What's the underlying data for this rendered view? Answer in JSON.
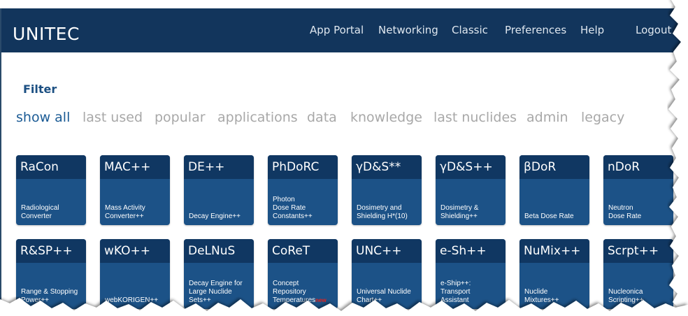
{
  "app": {
    "title": "UNITEC"
  },
  "nav": [
    {
      "id": "app-portal",
      "label": "App Portal"
    },
    {
      "id": "networking",
      "label": "Networking"
    },
    {
      "id": "classic",
      "label": "Classic"
    },
    {
      "id": "preferences",
      "label": "Preferences"
    },
    {
      "id": "help",
      "label": "Help"
    },
    {
      "id": "logout",
      "label": "Logout"
    }
  ],
  "filter": {
    "title": "Filter",
    "items": [
      "show all",
      "last used",
      "popular",
      "applications",
      "data",
      "knowledge",
      "last nuclides",
      "admin",
      "legacy"
    ],
    "active": "show all"
  },
  "tiles": [
    {
      "title": "RaCon",
      "desc": "Radiological\nConverter"
    },
    {
      "title": "MAC++",
      "desc": "Mass Activity\nConverter++"
    },
    {
      "title": "DE++",
      "desc": "Decay Engine++"
    },
    {
      "title": "PhDoRC",
      "desc": "Photon\nDose Rate\nConstants++"
    },
    {
      "title": "γD&S**",
      "desc": "Dosimetry and\nShielding H*(10)"
    },
    {
      "title": "γD&S++",
      "desc": "Dosimetry &\nShielding++"
    },
    {
      "title": "βDoR",
      "desc": "Beta Dose Rate"
    },
    {
      "title": "nDoR",
      "desc": "Neutron\nDose Rate"
    },
    {
      "title": "R&SP++",
      "desc": "Range & Stopping\nPower++"
    },
    {
      "title": "wKO++",
      "desc": "webKORIGEN++"
    },
    {
      "title": "DeLNuS",
      "desc": "Decay Engine for\nLarge Nuclide\nSets++"
    },
    {
      "title": "CoReT",
      "desc": "Concept\nRepository\nTemperatures",
      "badge": "new"
    },
    {
      "title": "UNC++",
      "desc": "Universal Nuclide\nChart++"
    },
    {
      "title": "e-Sh++",
      "desc": "e-Ship++:\nTransport\nAssistant"
    },
    {
      "title": "NuMix++",
      "desc": "Nuclide\nMixtures++"
    },
    {
      "title": "Scrpt++",
      "desc": "Nucleonica\nScripting++"
    }
  ],
  "colors": {
    "navbar": "#12355c",
    "tile": "#1c5287",
    "tile_head": "#103762",
    "active_filter": "#1b5b95",
    "inactive_filter": "#a8a8a8"
  }
}
